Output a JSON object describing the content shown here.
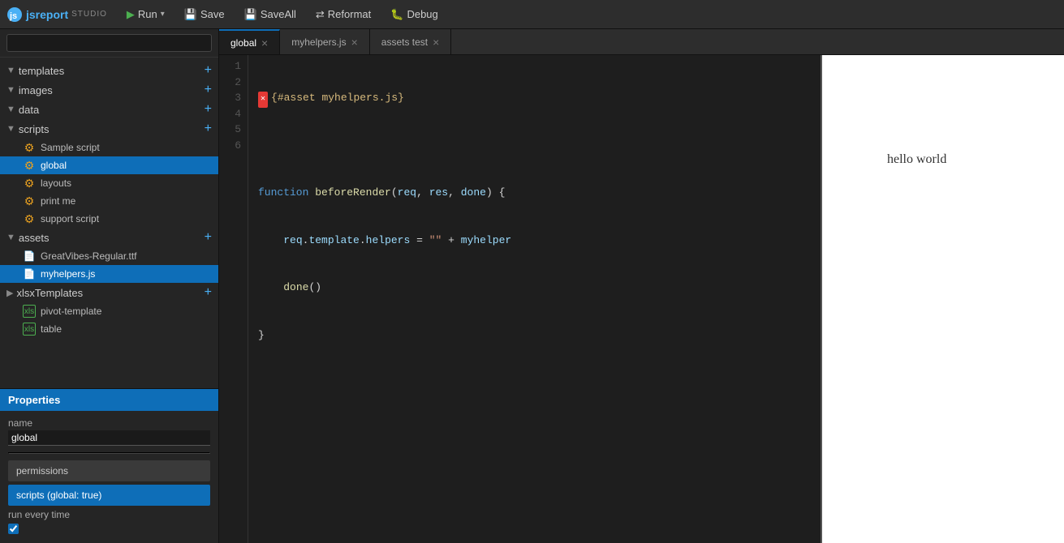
{
  "toolbar": {
    "logo_js": "js",
    "logo_report": "report",
    "logo_studio": "STUDIO",
    "run_label": "Run",
    "save_label": "Save",
    "saveall_label": "SaveAll",
    "reformat_label": "Reformat",
    "debug_label": "Debug"
  },
  "sidebar": {
    "search_placeholder": "",
    "sections": [
      {
        "id": "templates",
        "label": "templates",
        "expanded": true,
        "items": []
      },
      {
        "id": "images",
        "label": "images",
        "expanded": true,
        "items": []
      },
      {
        "id": "data",
        "label": "data",
        "expanded": true,
        "items": []
      },
      {
        "id": "scripts",
        "label": "scripts",
        "expanded": true,
        "items": [
          {
            "label": "Sample script",
            "active": false,
            "type": "gear"
          },
          {
            "label": "global",
            "active": true,
            "type": "gear"
          },
          {
            "label": "layouts",
            "active": false,
            "type": "gear"
          },
          {
            "label": "print me",
            "active": false,
            "type": "gear"
          },
          {
            "label": "support script",
            "active": false,
            "type": "gear"
          }
        ]
      },
      {
        "id": "assets",
        "label": "assets",
        "expanded": true,
        "items": [
          {
            "label": "GreatVibes-Regular.ttf",
            "active": false,
            "type": "file"
          },
          {
            "label": "myhelpers.js",
            "active": true,
            "type": "file"
          }
        ]
      },
      {
        "id": "xlsxTemplates",
        "label": "xlsxTemplates",
        "expanded": true,
        "items": [
          {
            "label": "pivot-template",
            "active": false,
            "type": "xlsx"
          },
          {
            "label": "table",
            "active": false,
            "type": "xlsx"
          }
        ]
      }
    ]
  },
  "properties": {
    "header": "Properties",
    "name_label": "name",
    "name_value": "global",
    "permissions_label": "permissions",
    "scripts_section_label": "scripts (global: true)",
    "run_every_time_label": "run every time",
    "run_every_time_checked": true
  },
  "tabs": [
    {
      "id": "global",
      "label": "global",
      "active": true,
      "closeable": true
    },
    {
      "id": "myhelpers",
      "label": "myhelpers.js",
      "active": false,
      "closeable": true
    },
    {
      "id": "assets-test",
      "label": "assets test",
      "active": false,
      "closeable": true
    }
  ],
  "code_editor": {
    "lines": [
      {
        "num": 1,
        "has_error": true,
        "content_html": "<span class='asset-tag'>{#asset myhelpers.js}</span>"
      },
      {
        "num": 2,
        "has_error": false,
        "content_html": ""
      },
      {
        "num": 3,
        "has_error": false,
        "content_html": "<span class='kw'>function</span> <span class='fn'>beforeRender</span><span class='punct'>(</span><span class='param'>req</span><span class='punct'>,</span> <span class='param'>res</span><span class='punct'>,</span> <span class='param'>done</span><span class='punct'>)</span> <span class='punct'>{</span>"
      },
      {
        "num": 4,
        "has_error": false,
        "content_html": "    <span class='param'>req</span><span class='punct'>.</span><span class='param'>template</span><span class='punct'>.</span><span class='param'>helpers</span> <span class='punct'>=</span> <span class='str'>\"\"</span> <span class='punct'>+</span> myhelper"
      },
      {
        "num": 5,
        "has_error": false,
        "content_html": "    <span class='fn'>done</span><span class='punct'>()</span>"
      },
      {
        "num": 6,
        "has_error": false,
        "content_html": "<span class='punct'>}</span>"
      }
    ]
  },
  "preview": {
    "hello_world_text": "hello world"
  }
}
